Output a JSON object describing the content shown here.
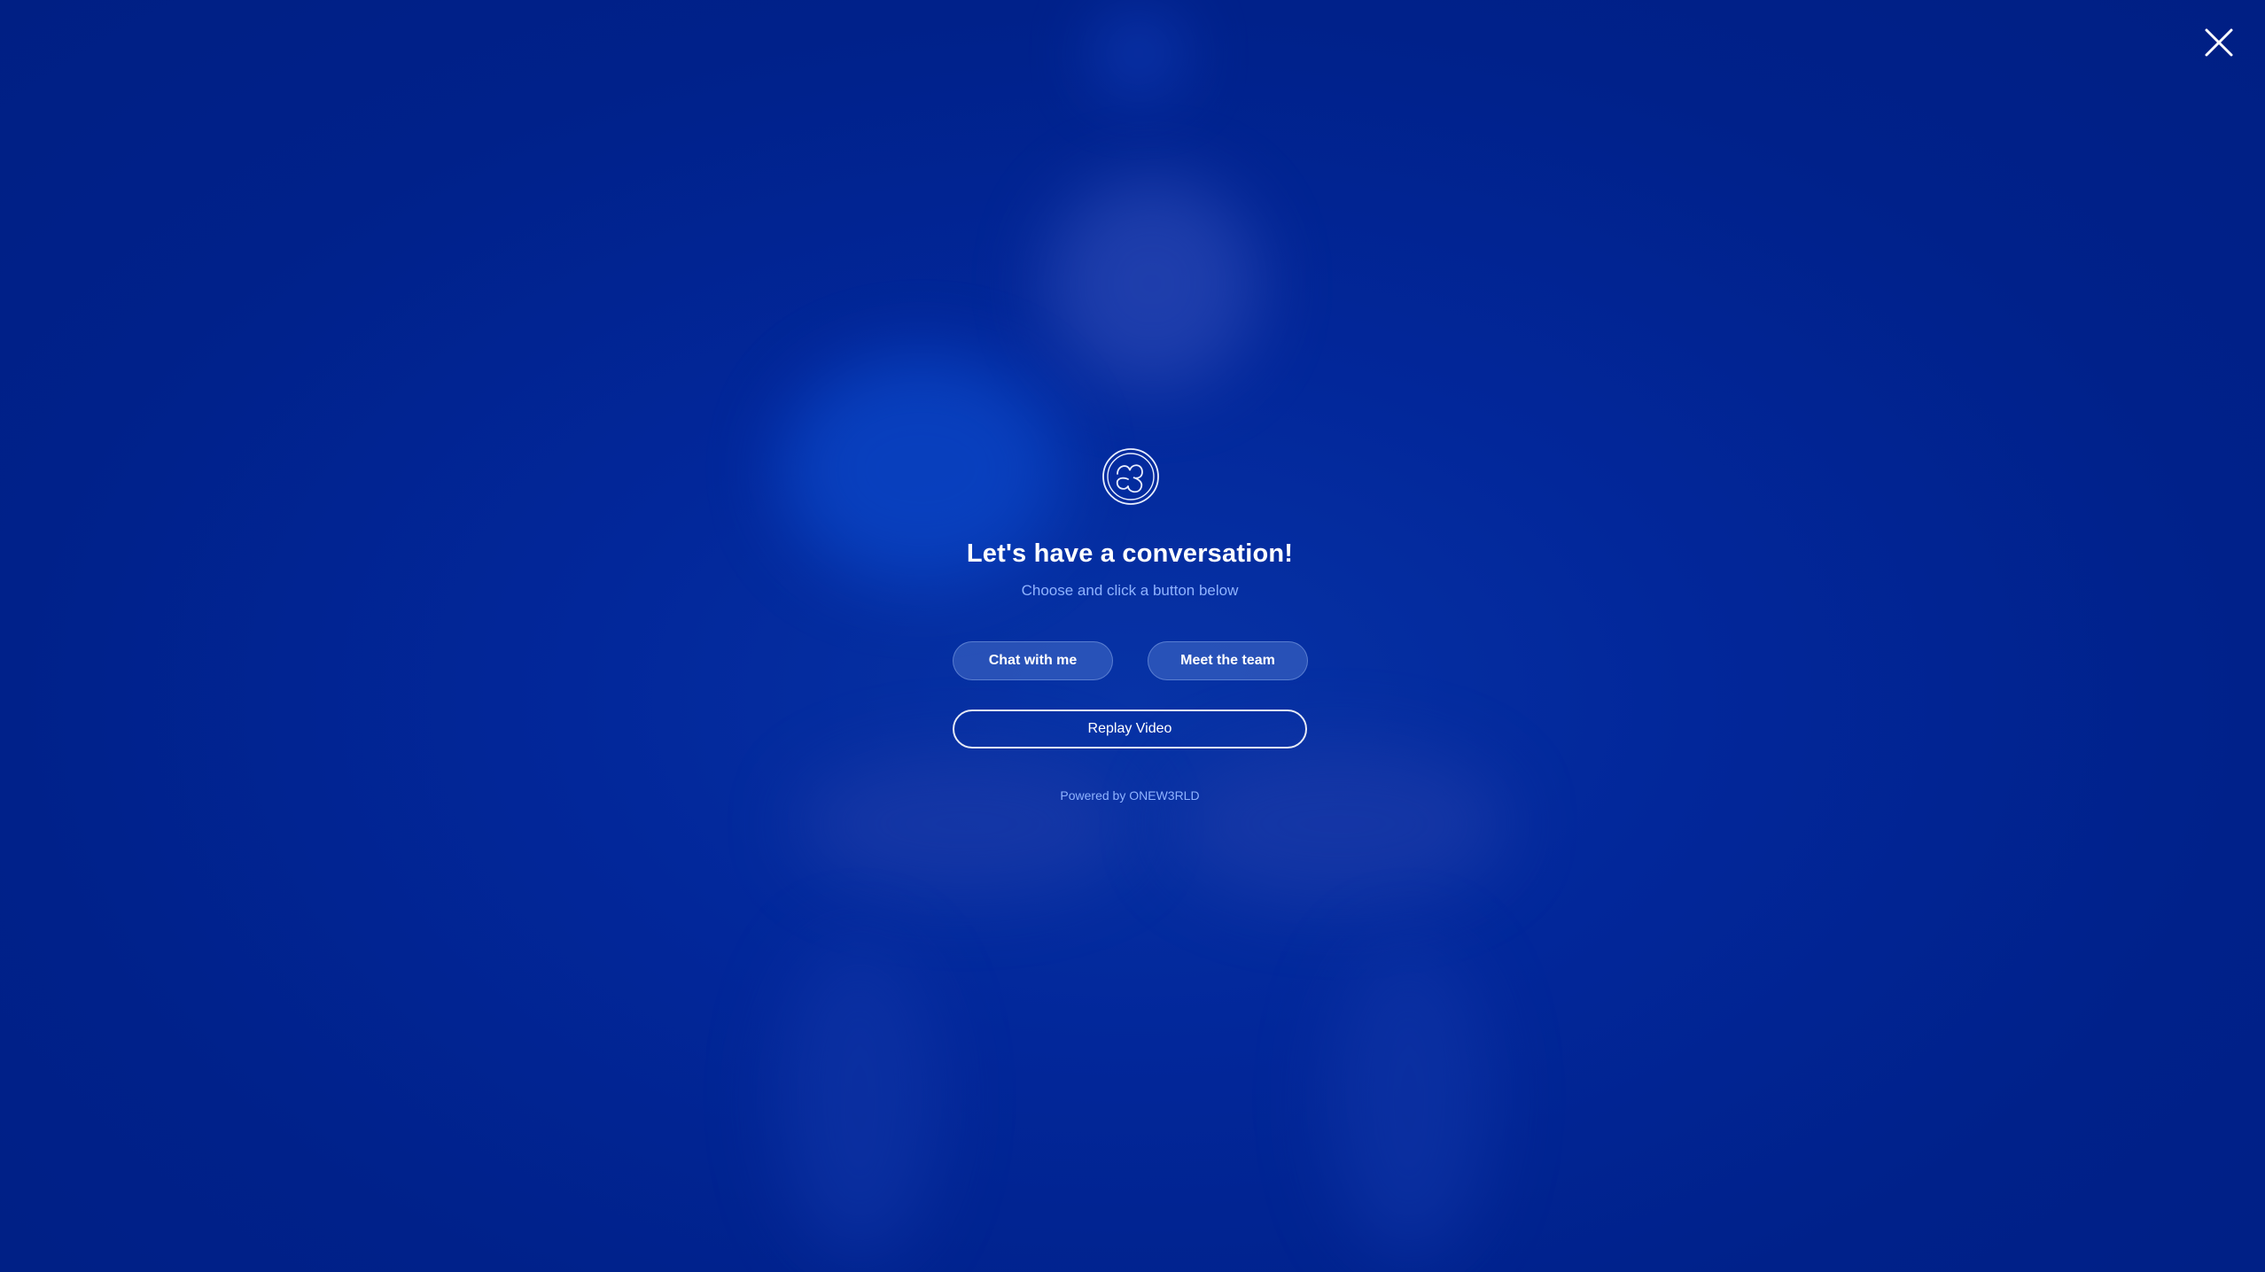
{
  "overlay": {
    "close_icon": "close-icon",
    "logo_icon": "onew3rld-logo-icon",
    "title": "Let's have a conversation!",
    "subtitle": "Choose and click a button below",
    "buttons": {
      "chat": "Chat with me",
      "team": "Meet the team",
      "replay": "Replay Video"
    },
    "powered_by": "Powered by ONEW3RLD"
  },
  "colors": {
    "background": "#00248a",
    "accent_text": "#8fb3ff",
    "button_fill": "#3f63b8",
    "text": "#ffffff"
  }
}
